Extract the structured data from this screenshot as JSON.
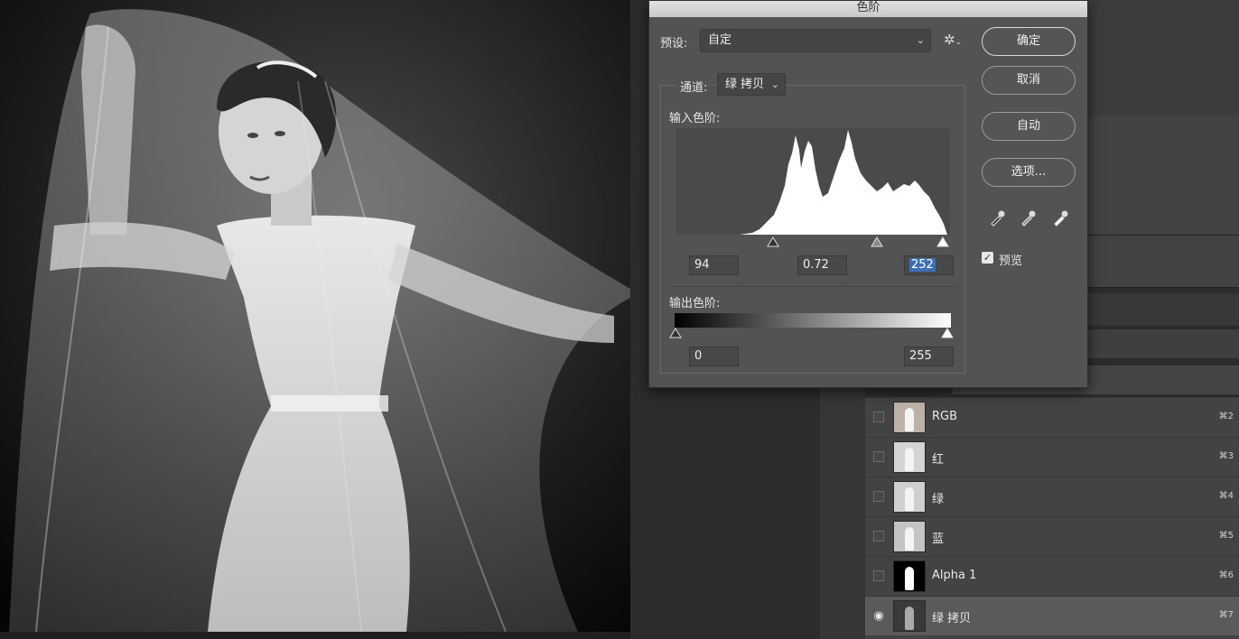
{
  "dialog": {
    "title": "色阶",
    "preset_label": "预设:",
    "preset_value": "自定",
    "gear_icon": "gear-icon",
    "channel_label": "通道:",
    "channel_value": "绿 拷贝",
    "input_levels_label": "输入色阶:",
    "input_black": "94",
    "input_gamma": "0.72",
    "input_white": "252",
    "output_levels_label": "输出色阶:",
    "output_black": "0",
    "output_white": "255",
    "buttons": {
      "ok": "确定",
      "cancel": "取消",
      "auto": "自动",
      "options": "选项..."
    },
    "preview_label": "预览",
    "preview_checked": true,
    "eyedroppers": [
      "black-eyedropper-icon",
      "gray-eyedropper-icon",
      "white-eyedropper-icon"
    ]
  },
  "channels_panel": {
    "rows": [
      {
        "name": "RGB",
        "shortcut": "⌘2",
        "visible": false,
        "selected": false
      },
      {
        "name": "红",
        "shortcut": "⌘3",
        "visible": false,
        "selected": false
      },
      {
        "name": "绿",
        "shortcut": "⌘4",
        "visible": false,
        "selected": false
      },
      {
        "name": "蓝",
        "shortcut": "⌘5",
        "visible": false,
        "selected": false
      },
      {
        "name": "Alpha 1",
        "shortcut": "⌘6",
        "visible": false,
        "selected": false
      },
      {
        "name": "绿 拷贝",
        "shortcut": "⌘7",
        "visible": true,
        "selected": true
      }
    ]
  },
  "colors": {
    "dialog_bg": "#535353",
    "selection_blue": "#3d6fb6",
    "panel_bg": "#434343"
  }
}
